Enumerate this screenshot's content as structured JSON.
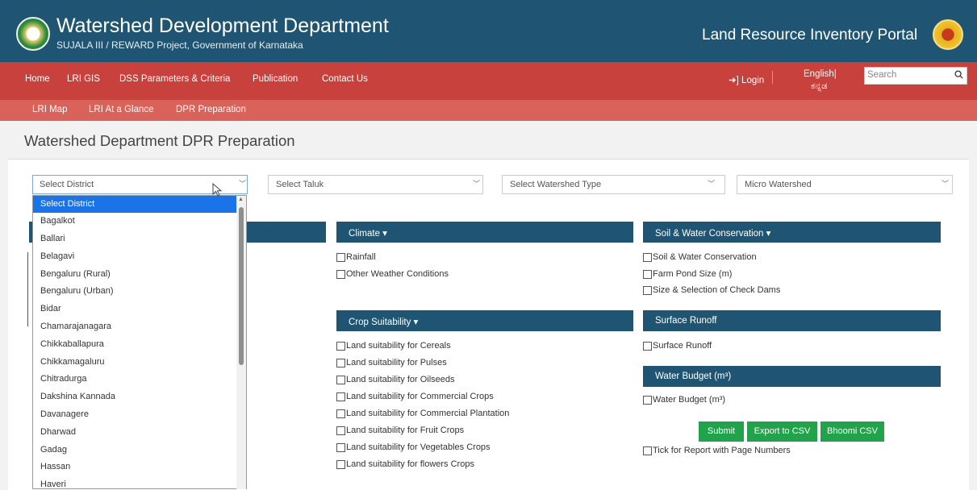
{
  "header": {
    "title": "Watershed Development Department",
    "subtitle": "SUJALA III / REWARD Project, Government of Karnataka",
    "portal_title": "Land Resource Inventory Portal"
  },
  "nav": {
    "items": [
      "Home",
      "LRI GIS",
      "DSS Parameters & Criteria",
      "Publication",
      "Contact Us"
    ],
    "login": "Login",
    "lang_en": "English|",
    "lang_kn": "ಕನ್ನಡ",
    "search_placeholder": "Search"
  },
  "subnav": {
    "items": [
      "LRI Map",
      "LRI At a Glance",
      "DPR Preparation"
    ]
  },
  "page": {
    "title": "Watershed Department DPR Preparation"
  },
  "filters": {
    "district": "Select District",
    "taluk": "Select Taluk",
    "watershed_type": "Select Watershed Type",
    "micro_watershed": "Micro Watershed"
  },
  "sections": {
    "climate": {
      "title": "Climate ▾",
      "items": [
        "Rainfall",
        "Other Weather Conditions"
      ]
    },
    "crop_suitability": {
      "title": "Crop Suitability ▾",
      "items": [
        "Land suitability for Cereals",
        "Land suitability for Pulses",
        "Land suitability for Oilseeds",
        "Land suitability for Commercial Crops",
        "Land suitability for Commercial Plantation",
        "Land suitability for Fruit Crops",
        "Land suitability for Vegetables Crops",
        "Land suitability for flowers Crops"
      ]
    },
    "soil_water": {
      "title": "Soil & Water Conservation ▾",
      "items": [
        "Soil & Water Conservation",
        "Farm Pond Size (m)",
        "Size & Selection of Check Dams"
      ]
    },
    "surface_runoff": {
      "title": "Surface Runoff",
      "items": [
        "Surface Runoff"
      ]
    },
    "water_budget": {
      "title": "Water Budget (m³)",
      "items": [
        "Water Budget (m³)"
      ]
    }
  },
  "buttons": {
    "submit": "Submit",
    "export": "Export to CSV",
    "bhoomi": "Bhoomi CSV"
  },
  "report_option": "Tick for Report with Page Numbers",
  "district_options": [
    "Select District",
    "Bagalkot",
    "Ballari",
    "Belagavi",
    "Bengaluru (Rural)",
    "Bengaluru (Urban)",
    "Bidar",
    "Chamarajanagara",
    "Chikkaballapura",
    "Chikkamagaluru",
    "Chitradurga",
    "Dakshina Kannada",
    "Davanagere",
    "Dharwad",
    "Gadag",
    "Hassan",
    "Haveri"
  ],
  "colors": {
    "header": "#1f5572",
    "nav": "#c8413c",
    "subnav": "#d9625a",
    "button": "#20a34a",
    "selected": "#1a73e8"
  }
}
